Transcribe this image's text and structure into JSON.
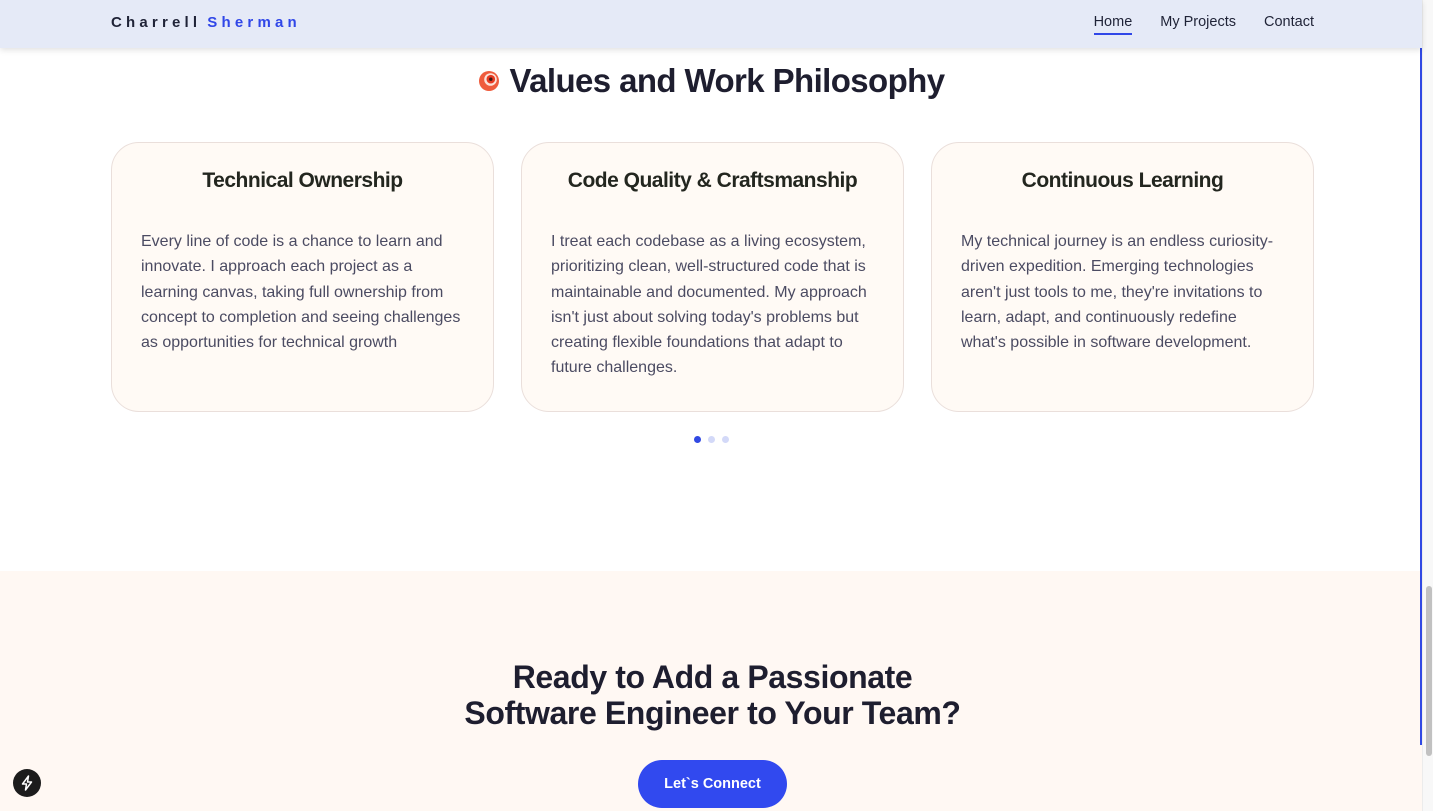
{
  "header": {
    "logo_first": "Charrell",
    "logo_last": "Sherman",
    "nav": [
      {
        "label": "Home",
        "active": true
      },
      {
        "label": "My Projects",
        "active": false
      },
      {
        "label": "Contact",
        "active": false
      }
    ]
  },
  "values_section": {
    "icon": "target-icon",
    "title": "Values and Work Philosophy",
    "cards": [
      {
        "title": "Technical Ownership",
        "body": "Every line of code is a chance to learn and innovate. I approach each project as a learning canvas, taking full ownership from concept to completion and seeing challenges as opportunities for technical growth"
      },
      {
        "title": "Code Quality & Craftsmanship",
        "body": "I treat each codebase as a living ecosystem, prioritizing clean, well-structured code that is maintainable and documented. My approach isn't just about solving today's problems but creating flexible foundations that adapt to future challenges."
      },
      {
        "title": "Continuous Learning",
        "body": "My technical journey is an endless curiosity-driven expedition. Emerging technologies aren't just tools to me, they're invitations to learn, adapt, and continuously redefine what's possible in software development."
      }
    ],
    "carousel": {
      "pages": 3,
      "active_index": 0
    }
  },
  "cta": {
    "title_line1": "Ready to Add a Passionate",
    "title_line2": "Software Engineer to Your Team?",
    "button_label": "Let`s Connect"
  },
  "floating": {
    "icon": "bolt-icon"
  },
  "colors": {
    "accent": "#3149e3",
    "header_bg": "#e5eaf7",
    "card_bg": "#fffaf5",
    "cta_bg": "#fff8f3"
  }
}
